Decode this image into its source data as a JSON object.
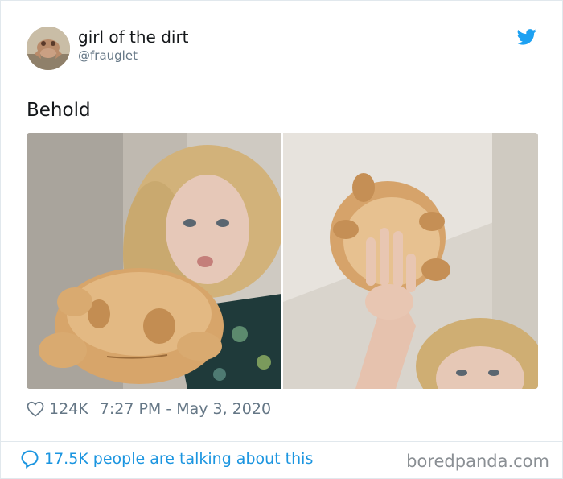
{
  "tweet": {
    "display_name": "girl of the dirt",
    "handle": "@frauglet",
    "text": "Behold",
    "likes": "124K",
    "timestamp": "7:27 PM - May 3, 2020",
    "brand_color": "#1da1f2"
  },
  "footer": {
    "talking_text": "17.5K people are talking about this",
    "watermark": "boredpanda.com"
  },
  "icons": {
    "brand": "twitter-bird-icon",
    "like": "heart-icon",
    "reply": "speech-bubble-icon"
  }
}
